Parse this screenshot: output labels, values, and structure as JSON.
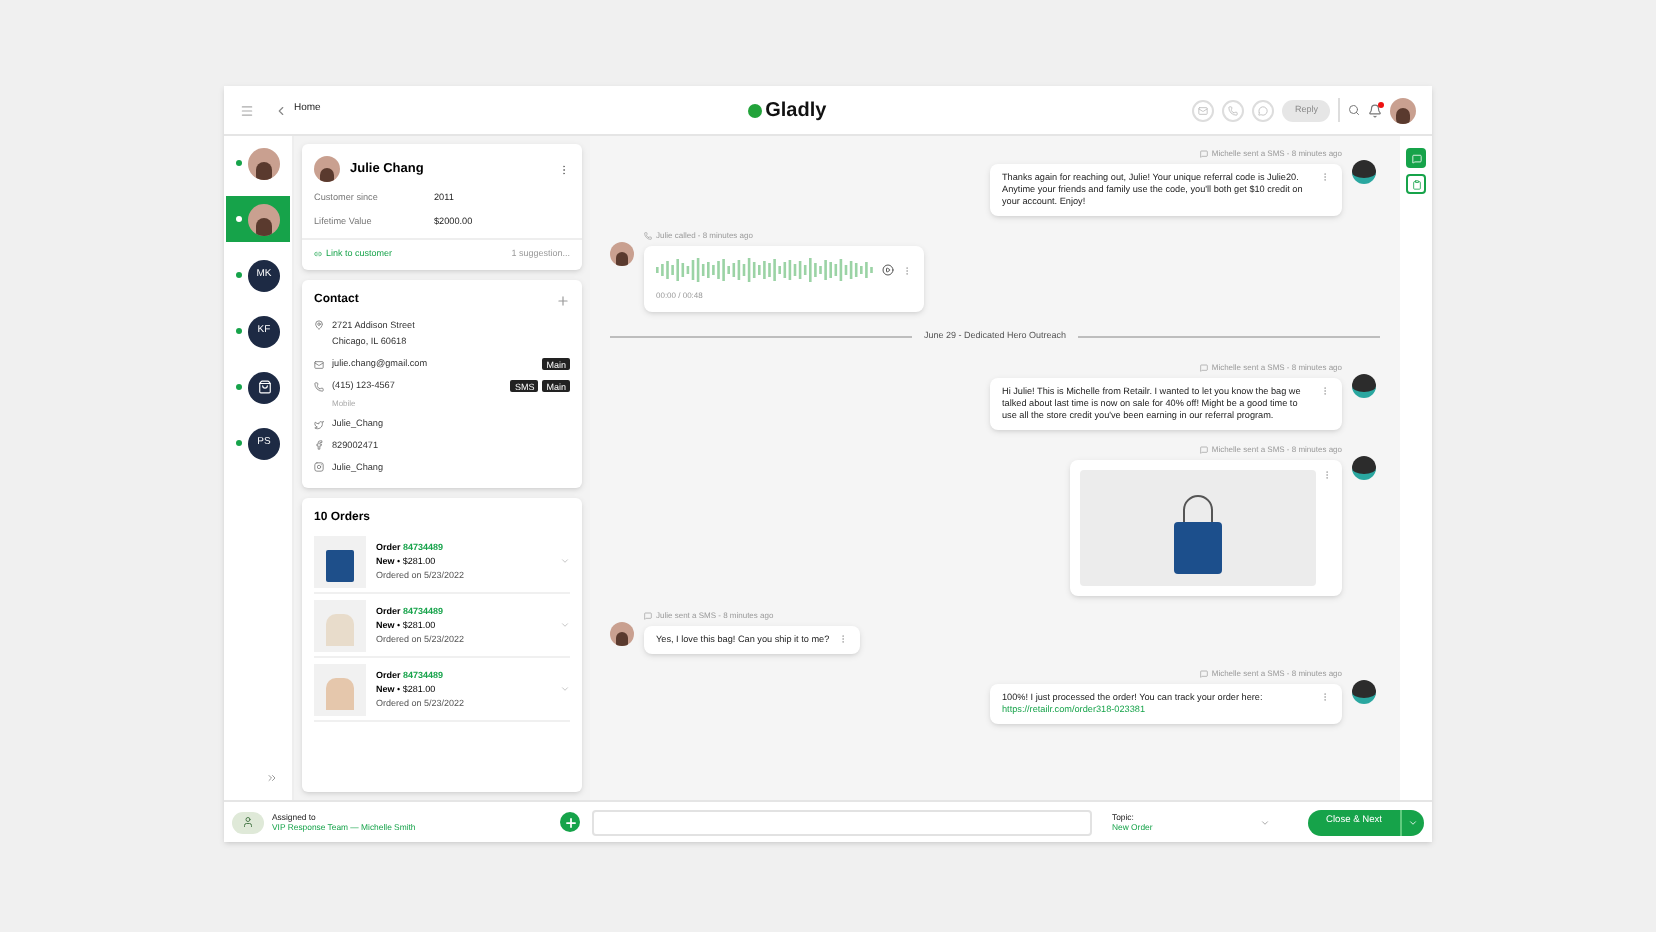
{
  "header": {
    "back_label": "Home",
    "logo": "Gladly",
    "reply_button": {
      "label": "Reply",
      "disabled": true
    },
    "notifications_unread": true
  },
  "rail": {
    "items": [
      {
        "kind": "photo",
        "online": true,
        "selected": false
      },
      {
        "kind": "photo",
        "online": true,
        "selected": true
      },
      {
        "kind": "initials",
        "initials": "MK",
        "online": true,
        "selected": false
      },
      {
        "kind": "initials",
        "initials": "KF",
        "online": true,
        "selected": false
      },
      {
        "kind": "bag",
        "online": true,
        "selected": false
      },
      {
        "kind": "initials",
        "initials": "PS",
        "online": true,
        "selected": false
      }
    ]
  },
  "customer": {
    "name": "Julie Chang",
    "fields": [
      {
        "label": "Customer since",
        "value": "2011"
      },
      {
        "label": "Lifetime Value",
        "value": "$2000.00"
      }
    ],
    "link_label": "Link to customer",
    "suggestions": "1 suggestion..."
  },
  "contact": {
    "title": "Contact",
    "entries": [
      {
        "kind": "address",
        "lines": [
          "2721 Addison Street",
          "Chicago, IL 60618"
        ]
      },
      {
        "kind": "email",
        "lines": [
          "julie.chang@gmail.com"
        ],
        "badges": [
          "Main"
        ]
      },
      {
        "kind": "phone",
        "lines": [
          "(415) 123-4567"
        ],
        "sub": "Mobile",
        "badges": [
          "SMS",
          "Main"
        ]
      },
      {
        "kind": "twitter",
        "lines": [
          "Julie_Chang"
        ]
      },
      {
        "kind": "facebook",
        "lines": [
          "829002471"
        ]
      },
      {
        "kind": "instagram",
        "lines": [
          "Julie_Chang"
        ]
      }
    ]
  },
  "orders": {
    "title": "10 Orders",
    "items": [
      {
        "kind": "bag",
        "label": "Order",
        "number": "84734489",
        "status": "New",
        "separator": "•",
        "price": "$281.00",
        "date": "Ordered on 5/23/2022"
      },
      {
        "kind": "dress",
        "label": "Order",
        "number": "84734489",
        "status": "New",
        "separator": "•",
        "price": "$281.00",
        "date": "Ordered on 5/23/2022"
      },
      {
        "kind": "top",
        "label": "Order",
        "number": "84734489",
        "status": "New",
        "separator": "•",
        "price": "$281.00",
        "date": "Ordered on 5/23/2022"
      }
    ]
  },
  "conversation": [
    {
      "kind": "message",
      "from_agent": true,
      "meta": "Michelle sent a SMS - 8 minutes ago",
      "text": "Thanks again for reaching out, Julie! Your unique referral code is Julie20. Anytime your friends and family use the code, you'll both get $10 credit on your account. Enjoy!"
    },
    {
      "kind": "call",
      "from_agent": false,
      "meta": "Julie called - 8 minutes ago",
      "time": "00:00 / 00:48"
    },
    {
      "kind": "divider",
      "text": "June 29 - Dedicated Hero Outreach"
    },
    {
      "kind": "message",
      "from_agent": true,
      "meta": "Michelle sent a SMS - 8 minutes ago",
      "text": "Hi Julie! This is Michelle from Retailr. I wanted to let you know the bag we talked about last time is now on sale for 40% off! Might be a good time to use all the store credit you've been earning in our referral program."
    },
    {
      "kind": "image",
      "from_agent": true,
      "meta": "Michelle sent a SMS - 8 minutes ago"
    },
    {
      "kind": "message",
      "from_agent": false,
      "meta": "Julie sent a SMS - 8 minutes ago",
      "text": "Yes, I love this bag! Can you ship it to me?"
    },
    {
      "kind": "message",
      "from_agent": true,
      "meta": "Michelle sent a SMS - 8 minutes ago",
      "text": "100%! I just processed the order! You can track your order here:",
      "link": "https://retailr.com/order318-023381"
    }
  ],
  "footer": {
    "assigned_label": "Assigned to",
    "assignee": "VIP Response Team — Michelle Smith",
    "topic_label": "Topic:",
    "topic": "New Order",
    "primary_button": "Close & Next"
  }
}
